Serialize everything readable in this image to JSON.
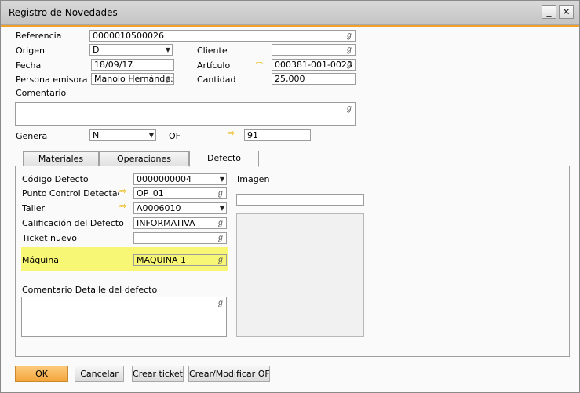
{
  "window": {
    "title": "Registro de Novedades",
    "minimize_glyph": "_",
    "close_glyph": "✕"
  },
  "header": {
    "referencia": {
      "label": "Referencia",
      "value": "0000010500026"
    },
    "origen": {
      "label": "Origen",
      "value": "D"
    },
    "cliente": {
      "label": "Cliente",
      "value": ""
    },
    "fecha": {
      "label": "Fecha",
      "value": "18/09/17"
    },
    "articulo": {
      "label": "Artículo",
      "value": "000381-001-0023"
    },
    "persona": {
      "label": "Persona emisora",
      "value": "Manolo Hernánde:"
    },
    "cantidad": {
      "label": "Cantidad",
      "value": "25,000"
    },
    "comentario": {
      "label": "Comentario",
      "value": ""
    },
    "genera": {
      "label": "Genera",
      "value": "N"
    },
    "of": {
      "label": "OF",
      "value": "91"
    }
  },
  "tabs": [
    {
      "label": "Materiales"
    },
    {
      "label": "Operaciones"
    },
    {
      "label": "Defecto",
      "active": true
    }
  ],
  "defecto": {
    "codigo": {
      "label": "Código Defecto",
      "value": "0000000004"
    },
    "punto_control": {
      "label": "Punto Control Detectado",
      "value": "OP_01"
    },
    "taller": {
      "label": "Taller",
      "value": "A0006010"
    },
    "calificacion": {
      "label": "Calificación del Defecto",
      "value": "INFORMATIVA"
    },
    "ticket": {
      "label": "Ticket nuevo",
      "value": ""
    },
    "maquina": {
      "label": "Máquina",
      "value": "MAQUINA 1"
    },
    "comentario_detalle": {
      "label": "Comentario Detalle del defecto",
      "value": ""
    },
    "imagen": {
      "label": "Imagen",
      "value": ""
    }
  },
  "footer": {
    "ok": "OK",
    "cancelar": "Cancelar",
    "crear_ticket": "Crear ticket",
    "crear_modificar_of": "Crear/Modificar OF"
  },
  "icons": {
    "link_arrow": "⇨",
    "search": "ℊ",
    "dropdown": "▼"
  },
  "colors": {
    "accent": "#f0a12a",
    "highlight": "#f7f775",
    "link_arrow": "#e8b400"
  }
}
